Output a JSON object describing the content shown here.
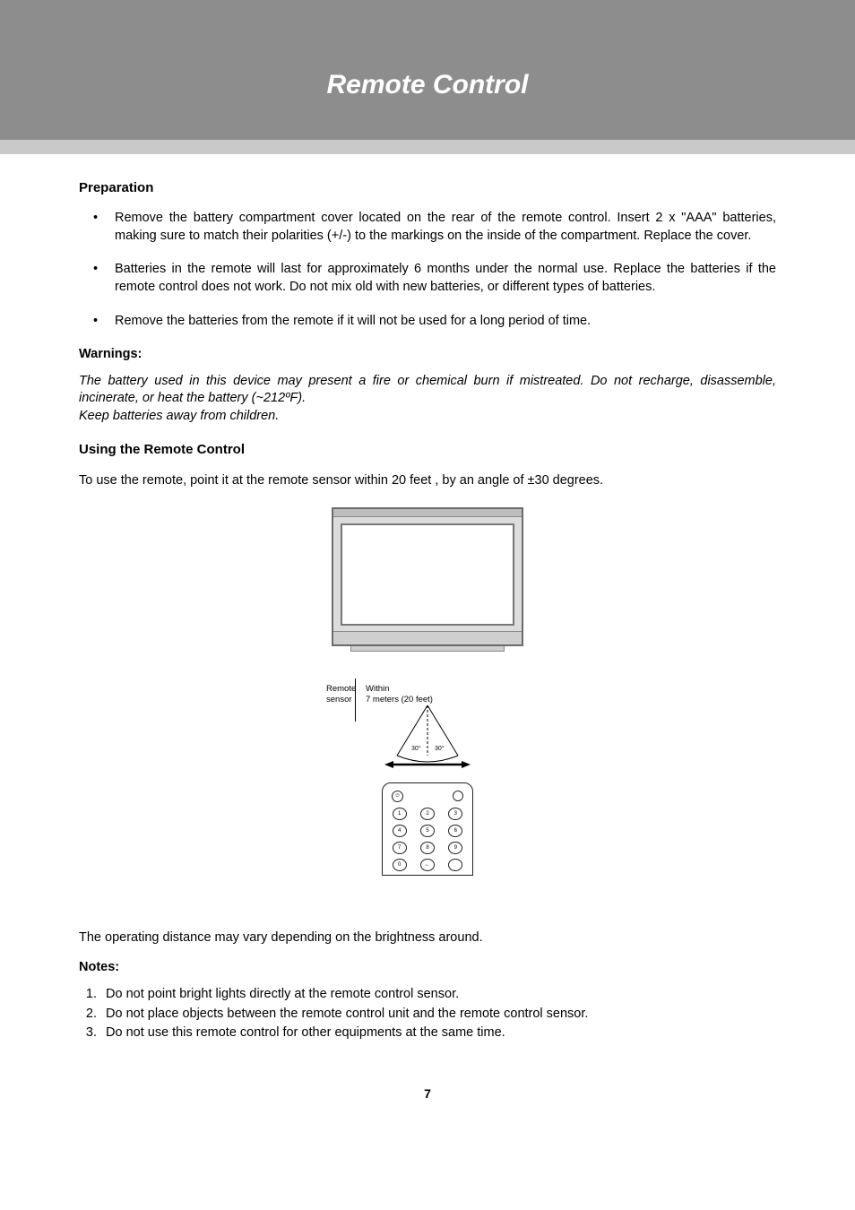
{
  "header": {
    "title": "Remote Control"
  },
  "sections": {
    "preparation": {
      "heading": "Preparation",
      "bullets": [
        "Remove the battery compartment cover located on the rear of the remote control. Insert 2 x \"AAA\" batteries, making sure to match their polarities (+/-) to the markings on the inside of the compartment. Replace the cover.",
        "Batteries in the remote will last for approximately 6 months under the normal use. Replace the batteries if the remote control does not work. Do not mix old with new batteries, or different types of batteries.",
        "Remove the batteries from the remote if it will not be used for a long period of time."
      ]
    },
    "warnings": {
      "label": "Warnings:",
      "text1": "The battery used in this device may present a fire or chemical burn if mistreated. Do not recharge, disassemble, incinerate, or heat the battery (~212ºF).",
      "text2": "Keep batteries away from children."
    },
    "using": {
      "heading": "Using the Remote Control",
      "para": "To use the remote, point it at the remote sensor within 20 feet , by an angle of ±30 degrees."
    },
    "diagram": {
      "sensorLabel1a": "Remote",
      "sensorLabel1b": "sensor",
      "sensorLabel2a": "Within",
      "sensorLabel2b": "7 meters (20 feet)",
      "angleLeft": "30°",
      "angleRight": "30°",
      "remoteButtons": [
        "1",
        "2",
        "3",
        "4",
        "5",
        "6",
        "7",
        "8",
        "9",
        "0",
        "←",
        ""
      ]
    },
    "operatingDistance": "The operating distance may vary depending on the brightness around.",
    "notes": {
      "label": "Notes:",
      "items": [
        "Do not point bright lights directly at the remote control sensor.",
        "Do not place objects between the remote control unit and the remote control sensor.",
        "Do not use this remote control for other equipments at the same time."
      ]
    }
  },
  "page": "7"
}
